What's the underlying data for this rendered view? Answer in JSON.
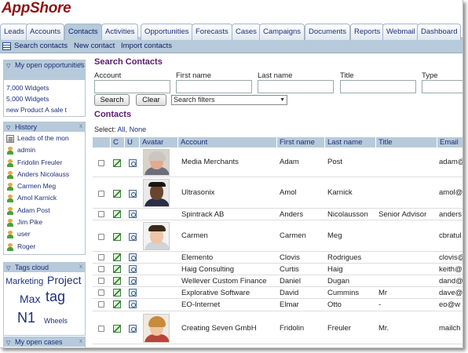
{
  "app": {
    "title": "AppShore"
  },
  "tabs": [
    {
      "label": "Leads"
    },
    {
      "label": "Accounts"
    },
    {
      "label": "Contacts",
      "active": true
    },
    {
      "label": "Activities"
    },
    {
      "label": "Opportunities"
    },
    {
      "label": "Forecasts"
    },
    {
      "label": "Cases"
    },
    {
      "label": "Campaigns"
    },
    {
      "label": "Documents"
    },
    {
      "label": "Reports"
    },
    {
      "label": "Webmail"
    },
    {
      "label": "Dashboard"
    }
  ],
  "subnav": {
    "search": "Search contacts",
    "new": "New contact",
    "import": "Import contacts"
  },
  "sidebar": {
    "opportunities": {
      "title": "My open opportunities",
      "items": [
        "7,000 Widgets",
        "5,000 Widgets",
        "new Product A sale t"
      ]
    },
    "history": {
      "title": "History",
      "items": [
        {
          "label": "Leads of the mon",
          "icon": "report-icon"
        },
        {
          "label": "admin",
          "icon": "user-icon"
        },
        {
          "label": "Fridolin Freuler",
          "icon": "user-icon"
        },
        {
          "label": "Anders Nicolauss",
          "icon": "user-icon"
        },
        {
          "label": "Carmen Meg",
          "icon": "user-icon"
        },
        {
          "label": "Amol Karnick",
          "icon": "user-icon"
        },
        {
          "label": "Adam Post",
          "icon": "user-icon"
        },
        {
          "label": "Jim Pike",
          "icon": "user-icon"
        },
        {
          "label": "user",
          "icon": "user-icon"
        },
        {
          "label": "Roger",
          "icon": "user-icon"
        }
      ]
    },
    "tags": {
      "title": "Tags cloud",
      "items": [
        {
          "label": "Marketing"
        },
        {
          "label": "Project"
        },
        {
          "label": "Max"
        },
        {
          "label": "tag"
        },
        {
          "label": "N1"
        },
        {
          "label": "Wheels"
        }
      ]
    },
    "cases": {
      "title": "My open cases"
    },
    "close_glyph": "x"
  },
  "search": {
    "title": "Search Contacts",
    "fields": [
      {
        "label": "Account",
        "value": ""
      },
      {
        "label": "First name",
        "value": ""
      },
      {
        "label": "Last name",
        "value": ""
      },
      {
        "label": "Title",
        "value": ""
      },
      {
        "label": "Type",
        "value": ""
      }
    ],
    "search_button": "Search",
    "clear_button": "Clear",
    "filter_select": "Search filters"
  },
  "contacts": {
    "title": "Contacts",
    "select_label": "Select:",
    "select_all": "All",
    "select_none": "None",
    "columns": [
      "C",
      "U",
      "Avatar",
      "Account",
      "First name",
      "Last name",
      "Title",
      "Email"
    ],
    "rows": [
      {
        "account": "Media Merchants",
        "first": "Adam",
        "last": "Post",
        "title": "",
        "email": "adam@",
        "avatar": "avatar-adam"
      },
      {
        "account": "Ultrasonix",
        "first": "Amol",
        "last": "Karnick",
        "title": "",
        "email": "amol@",
        "avatar": "avatar-amol"
      },
      {
        "account": "Spintrack AB",
        "first": "Anders",
        "last": "Nicolausson",
        "title": "Senior Advisor",
        "email": "anders",
        "avatar": ""
      },
      {
        "account": "Carmen",
        "first": "Carmen",
        "last": "Meg",
        "title": "",
        "email": "cbratul",
        "avatar": "avatar-carmen"
      },
      {
        "account": "Elemento",
        "first": "Clovis",
        "last": "Rodrigues",
        "title": "",
        "email": "clovis@",
        "avatar": ""
      },
      {
        "account": "Haig Consulting",
        "first": "Curtis",
        "last": "Haig",
        "title": "",
        "email": "keith@",
        "avatar": ""
      },
      {
        "account": "Wellever Custom Finance",
        "first": "Daniel",
        "last": "Dugan",
        "title": "",
        "email": "dand@",
        "avatar": ""
      },
      {
        "account": "Explorative Software",
        "first": "David",
        "last": "Cummins",
        "title": "Mr",
        "email": "dave@",
        "avatar": ""
      },
      {
        "account": "EO-Internet",
        "first": "Elmar",
        "last": "Otto",
        "title": "-",
        "email": "eo@w",
        "avatar": ""
      },
      {
        "account": "Creating Seven GmbH",
        "first": "Fridolin",
        "last": "Freuler",
        "title": "Mr.",
        "email": "mailch",
        "avatar": "avatar-fridolin"
      }
    ]
  }
}
